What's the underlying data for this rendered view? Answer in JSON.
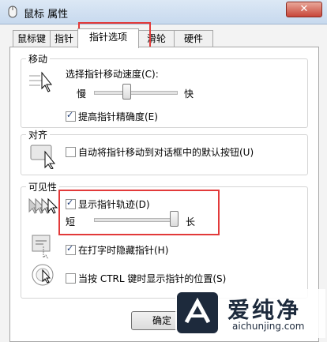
{
  "window": {
    "title": "鼠标 属性",
    "close_label": "✕"
  },
  "tabs": [
    {
      "label": "鼠标键",
      "active": false
    },
    {
      "label": "指针",
      "active": false
    },
    {
      "label": "指针选项",
      "active": true
    },
    {
      "label": "滑轮",
      "active": false
    },
    {
      "label": "硬件",
      "active": false
    }
  ],
  "motion": {
    "label": "移动",
    "speed_label": "选择指针移动速度(C):",
    "slow": "慢",
    "fast": "快",
    "speed_level": 0.4,
    "precision_label": "提高指针精确度(E)",
    "precision_checked": true
  },
  "snap": {
    "label": "对齐",
    "snap_label": "自动将指针移动到对话框中的默认按钮(U)",
    "snap_checked": false
  },
  "visibility": {
    "label": "可见性",
    "trails_label": "显示指针轨迹(D)",
    "trails_checked": true,
    "short": "短",
    "long": "长",
    "trails_level": 1.0,
    "hide_label": "在打字时隐藏指针(H)",
    "hide_checked": true,
    "ctrl_label": "当按 CTRL 键时显示指针的位置(S)",
    "ctrl_checked": false
  },
  "buttons": {
    "ok": "确定"
  },
  "watermark": {
    "name": "爱纯净",
    "url": "aichunjing.com"
  },
  "colors": {
    "highlight": "#e23a3a",
    "check": "#1c3a75"
  }
}
